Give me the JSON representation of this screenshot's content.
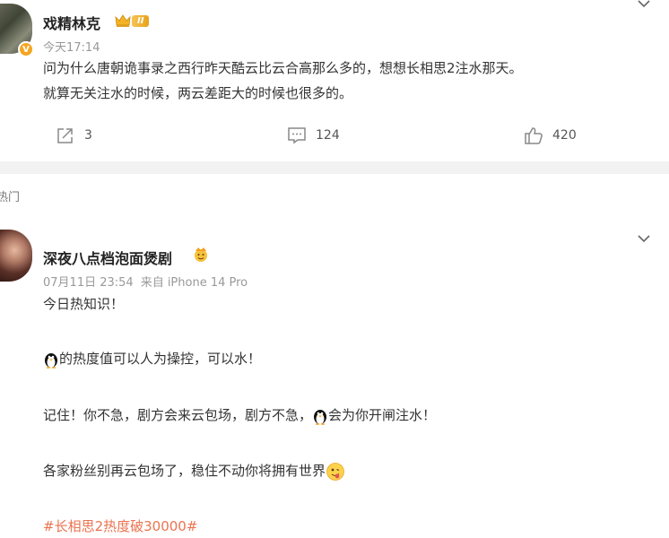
{
  "post1": {
    "username": "戏精林克",
    "level_badge": "II",
    "timestamp": "今天17:14",
    "text_line1": "问为什么唐朝诡事录之西行昨天酷云比云合高那么多的，想想长相思2注水那天。",
    "text_line2": "就算无关注水的时候，两云差距大的时候也很多的。",
    "actions": {
      "share_count": "3",
      "comment_count": "124",
      "like_count": "420"
    }
  },
  "section": {
    "hot_label": "热门"
  },
  "post2": {
    "username": "深夜八点档泡面煲剧",
    "date": "07月11日 23:54",
    "source": "来自 iPhone 14 Pro",
    "line1": "今日热知识！",
    "line2": "的热度值可以人为操控，可以水！",
    "line3a": "记住！你不急，剧方会来云包场，剧方不急，",
    "line3b": "会为你开闸注水！",
    "line4": "各家粉丝别再云包场了，稳住不动你将拥有世界",
    "hashtag": "#长相思2热度破30000#"
  },
  "colors": {
    "accent": "#eb7350",
    "badge_gold": "#f5a623",
    "divider": "#f2f2f2"
  }
}
